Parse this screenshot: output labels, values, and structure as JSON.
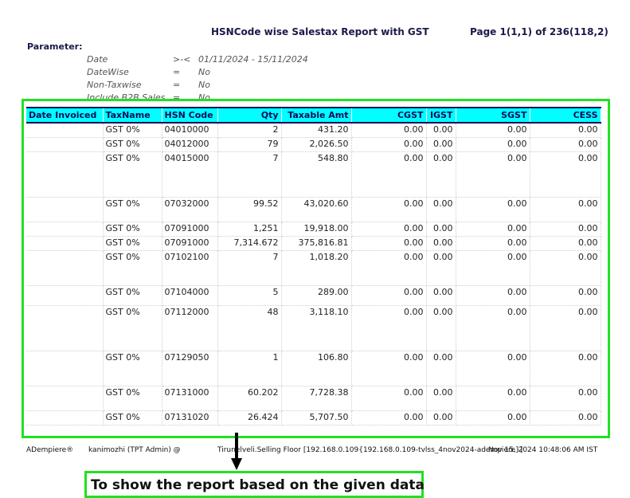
{
  "report": {
    "title": "HSNCode wise Salestax Report with GST",
    "page_info": "Page 1(1,1) of 236(118,2)",
    "parameter_label": "Parameter:",
    "parameters": [
      {
        "name": "Date",
        "op": ">-<",
        "value": "01/11/2024 - 15/11/2024"
      },
      {
        "name": "DateWise",
        "op": "=",
        "value": "No"
      },
      {
        "name": "Non-Taxwise",
        "op": "=",
        "value": "No"
      },
      {
        "name": "Include B2B Sales",
        "op": "=",
        "value": "No"
      }
    ],
    "columns": [
      "Date Invoiced",
      "TaxName",
      "HSN Code",
      "Qty",
      "Taxable Amt",
      "CGST",
      "IGST",
      "SGST",
      "CESS"
    ],
    "rows": [
      {
        "date": "",
        "tax": "GST 0%",
        "hsn": "04010000",
        "qty": "2",
        "amt": "431.20",
        "cgst": "0.00",
        "igst": "0.00",
        "sgst": "0.00",
        "cess": "0.00"
      },
      {
        "date": "",
        "tax": "GST 0%",
        "hsn": "04012000",
        "qty": "79",
        "amt": "2,026.50",
        "cgst": "0.00",
        "igst": "0.00",
        "sgst": "0.00",
        "cess": "0.00"
      },
      {
        "date": "",
        "tax": "GST 0%",
        "hsn": "04015000",
        "qty": "7",
        "amt": "548.80",
        "cgst": "0.00",
        "igst": "0.00",
        "sgst": "0.00",
        "cess": "0.00"
      },
      {
        "date": "",
        "tax": "GST 0%",
        "hsn": "07032000",
        "qty": "99.52",
        "amt": "43,020.60",
        "cgst": "0.00",
        "igst": "0.00",
        "sgst": "0.00",
        "cess": "0.00"
      },
      {
        "date": "",
        "tax": "GST 0%",
        "hsn": "07091000",
        "qty": "1,251",
        "amt": "19,918.00",
        "cgst": "0.00",
        "igst": "0.00",
        "sgst": "0.00",
        "cess": "0.00"
      },
      {
        "date": "",
        "tax": "GST 0%",
        "hsn": "07091000",
        "qty": "7,314.672",
        "amt": "375,816.81",
        "cgst": "0.00",
        "igst": "0.00",
        "sgst": "0.00",
        "cess": "0.00"
      },
      {
        "date": "",
        "tax": "GST 0%",
        "hsn": "07102100",
        "qty": "7",
        "amt": "1,018.20",
        "cgst": "0.00",
        "igst": "0.00",
        "sgst": "0.00",
        "cess": "0.00"
      },
      {
        "date": "",
        "tax": "GST 0%",
        "hsn": "07104000",
        "qty": "5",
        "amt": "289.00",
        "cgst": "0.00",
        "igst": "0.00",
        "sgst": "0.00",
        "cess": "0.00"
      },
      {
        "date": "",
        "tax": "GST 0%",
        "hsn": "07112000",
        "qty": "48",
        "amt": "3,118.10",
        "cgst": "0.00",
        "igst": "0.00",
        "sgst": "0.00",
        "cess": "0.00"
      },
      {
        "date": "",
        "tax": "GST 0%",
        "hsn": "07129050",
        "qty": "1",
        "amt": "106.80",
        "cgst": "0.00",
        "igst": "0.00",
        "sgst": "0.00",
        "cess": "0.00"
      },
      {
        "date": "",
        "tax": "GST 0%",
        "hsn": "07131000",
        "qty": "60.202",
        "amt": "7,728.38",
        "cgst": "0.00",
        "igst": "0.00",
        "sgst": "0.00",
        "cess": "0.00"
      },
      {
        "date": "",
        "tax": "GST 0%",
        "hsn": "07131020",
        "qty": "26.424",
        "amt": "5,707.50",
        "cgst": "0.00",
        "igst": "0.00",
        "sgst": "0.00",
        "cess": "0.00"
      }
    ],
    "footer": {
      "app": "ADempiere®",
      "user": "kanimozhi (TPT Admin) @",
      "location": "Tirunelveli.Selling Floor [192.168.0.109{192.168.0.109-tvlss_4nov2024-adempiere}]",
      "timestamp": "Nov 15, 2024 10:48:06 AM IST"
    }
  },
  "annotation": {
    "note": "To show the report based on the given data",
    "highlight_color": "#22e022"
  },
  "colors": {
    "header_bg": "#00ffff",
    "header_text": "#0a0a5a"
  }
}
